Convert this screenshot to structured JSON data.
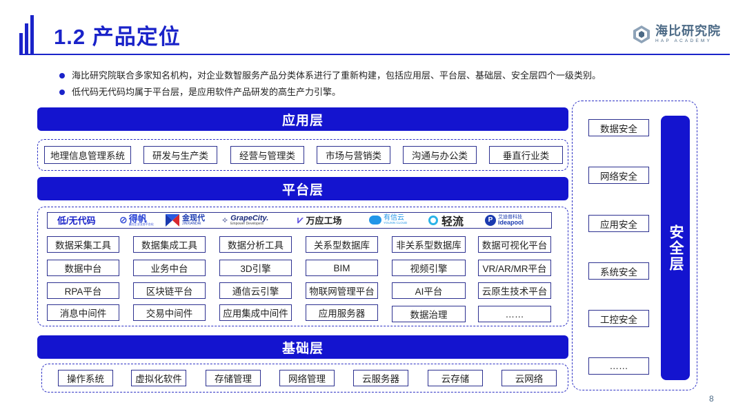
{
  "header": {
    "title": "1.2 产品定位",
    "logo_cn": "海比研究院",
    "logo_en": "HAP ACADEMY"
  },
  "bullets": [
    "海比研究院联合多家知名机构，对企业数智服务产品分类体系进行了重新构建，包括应用层、平台层、基础层、安全层四个一级类别。",
    "低代码无代码均属于平台层，是应用软件产品研发的高生产力引擎。"
  ],
  "application_layer": {
    "title": "应用层",
    "items": [
      "地理信息管理系统",
      "研发与生产类",
      "经营与管理类",
      "市场与营销类",
      "沟通与办公类",
      "垂直行业类"
    ]
  },
  "platform_layer": {
    "title": "平台层",
    "lowcode_label": "低/无代码",
    "vendors": [
      {
        "name": "得帆",
        "sub": "赢在企业业务平台化"
      },
      {
        "name": "金现代",
        "sub": "JINXIANDAI"
      },
      {
        "name": "GrapeCity.",
        "sub": "Empower Developers"
      },
      {
        "name": "万应工场",
        "sub": ""
      },
      {
        "name": "有信云",
        "sub": "YOUXIN CLOUD"
      },
      {
        "name": "轻流",
        "sub": ""
      },
      {
        "name": "艾迪普科技",
        "sub": "ideapool"
      }
    ],
    "rows": [
      [
        "数据采集工具",
        "数据集成工具",
        "数据分析工具",
        "关系型数据库",
        "非关系型数据库",
        "数据可视化平台"
      ],
      [
        "数据中台",
        "业务中台",
        "3D引擎",
        "BIM",
        "视频引擎",
        "VR/AR/MR平台"
      ],
      [
        "RPA平台",
        "区块链平台",
        "通信云引擎",
        "物联网管理平台",
        "AI平台",
        "云原生技术平台"
      ],
      [
        "消息中间件",
        "交易中间件",
        "应用集成中间件",
        "应用服务器",
        "数据治理",
        "……"
      ]
    ]
  },
  "base_layer": {
    "title": "基础层",
    "items": [
      "操作系统",
      "虚拟化软件",
      "存储管理",
      "网络管理",
      "云服务器",
      "云存储",
      "云网络"
    ]
  },
  "security_layer": {
    "title": "安全层",
    "items": [
      "数据安全",
      "网络安全",
      "应用安全",
      "系统安全",
      "工控安全",
      "……"
    ]
  },
  "page_number": "8",
  "colors": {
    "brand_blue": "#1414cf",
    "border": "#2b2f8f",
    "logo_gray": "#4c6a86"
  }
}
